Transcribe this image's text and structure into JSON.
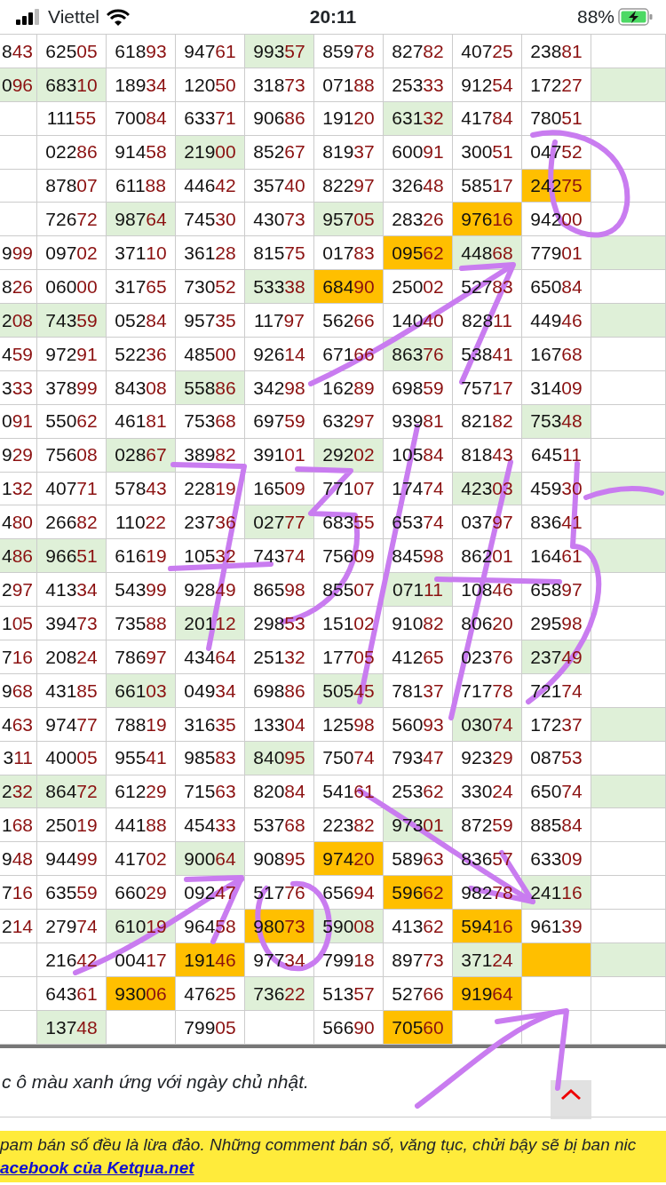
{
  "status_bar": {
    "carrier": "Viettel",
    "time": "20:11",
    "battery": "88%"
  },
  "rows": [
    [
      {
        "text": "843"
      },
      {
        "text": "62505"
      },
      {
        "text": "61893"
      },
      {
        "text": "94761"
      },
      {
        "text": "99357",
        "sunday": true
      },
      {
        "text": "85978"
      },
      {
        "text": "82782"
      },
      {
        "text": "40725"
      },
      {
        "text": "23881"
      },
      {}
    ],
    [
      {
        "text": "096",
        "sunday": true
      },
      {
        "text": "68310",
        "sunday": true
      },
      {
        "text": "18934"
      },
      {
        "text": "12050"
      },
      {
        "text": "31873"
      },
      {
        "text": "07188"
      },
      {
        "text": "25333"
      },
      {
        "text": "91254"
      },
      {
        "text": "17227"
      },
      {
        "sunday": true
      }
    ],
    [
      {},
      {
        "text": "11155"
      },
      {
        "text": "70084"
      },
      {
        "text": "63371"
      },
      {
        "text": "90686"
      },
      {
        "text": "19120"
      },
      {
        "text": "63132",
        "sunday": true
      },
      {
        "text": "41784"
      },
      {
        "text": "78051"
      },
      {}
    ],
    [
      {},
      {
        "text": "02286"
      },
      {
        "text": "91458"
      },
      {
        "text": "21900",
        "sunday": true
      },
      {
        "text": "85267"
      },
      {
        "text": "81937"
      },
      {
        "text": "60091"
      },
      {
        "text": "30051"
      },
      {
        "text": "04752"
      },
      {}
    ],
    [
      {},
      {
        "text": "87807"
      },
      {
        "text": "61188"
      },
      {
        "text": "44642"
      },
      {
        "text": "35740"
      },
      {
        "text": "82297"
      },
      {
        "text": "32648"
      },
      {
        "text": "58517"
      },
      {
        "text": "24275",
        "marked": true
      },
      {}
    ],
    [
      {},
      {
        "text": "72672"
      },
      {
        "text": "98764",
        "sunday": true
      },
      {
        "text": "74530"
      },
      {
        "text": "43073"
      },
      {
        "text": "95705",
        "sunday": true
      },
      {
        "text": "28326"
      },
      {
        "text": "97616",
        "marked": true
      },
      {
        "text": "94200"
      },
      {}
    ],
    [
      {
        "text": "999"
      },
      {
        "text": "09702"
      },
      {
        "text": "37110"
      },
      {
        "text": "36128"
      },
      {
        "text": "81575"
      },
      {
        "text": "01783"
      },
      {
        "text": "09562",
        "marked": true
      },
      {
        "text": "44868",
        "sunday": true
      },
      {
        "text": "77901"
      },
      {
        "sunday": true
      }
    ],
    [
      {
        "text": "826"
      },
      {
        "text": "06000"
      },
      {
        "text": "31765"
      },
      {
        "text": "73052"
      },
      {
        "text": "53338",
        "sunday": true
      },
      {
        "text": "68490",
        "marked": true
      },
      {
        "text": "25002"
      },
      {
        "text": "52783"
      },
      {
        "text": "65084"
      },
      {}
    ],
    [
      {
        "text": "208",
        "sunday": true
      },
      {
        "text": "74359",
        "sunday": true
      },
      {
        "text": "05284"
      },
      {
        "text": "95735"
      },
      {
        "text": "11797"
      },
      {
        "text": "56266"
      },
      {
        "text": "14040"
      },
      {
        "text": "82811"
      },
      {
        "text": "44946"
      },
      {
        "sunday": true
      }
    ],
    [
      {
        "text": "459"
      },
      {
        "text": "97291"
      },
      {
        "text": "52236"
      },
      {
        "text": "48500"
      },
      {
        "text": "92614"
      },
      {
        "text": "67166"
      },
      {
        "text": "86376",
        "sunday": true
      },
      {
        "text": "53841"
      },
      {
        "text": "16768"
      },
      {}
    ],
    [
      {
        "text": "333"
      },
      {
        "text": "37899"
      },
      {
        "text": "84308"
      },
      {
        "text": "55886",
        "sunday": true
      },
      {
        "text": "34298"
      },
      {
        "text": "16289"
      },
      {
        "text": "69859"
      },
      {
        "text": "75717"
      },
      {
        "text": "31409"
      },
      {}
    ],
    [
      {
        "text": "091"
      },
      {
        "text": "55062"
      },
      {
        "text": "46181"
      },
      {
        "text": "75368"
      },
      {
        "text": "69759"
      },
      {
        "text": "63297"
      },
      {
        "text": "93981"
      },
      {
        "text": "82182"
      },
      {
        "text": "75348",
        "sunday": true
      },
      {}
    ],
    [
      {
        "text": "929"
      },
      {
        "text": "75608"
      },
      {
        "text": "02867",
        "sunday": true
      },
      {
        "text": "38982"
      },
      {
        "text": "39101"
      },
      {
        "text": "29202",
        "sunday": true
      },
      {
        "text": "10584"
      },
      {
        "text": "81843"
      },
      {
        "text": "64511"
      },
      {}
    ],
    [
      {
        "text": "132"
      },
      {
        "text": "40771"
      },
      {
        "text": "57843"
      },
      {
        "text": "22819"
      },
      {
        "text": "16509"
      },
      {
        "text": "77107"
      },
      {
        "text": "17474"
      },
      {
        "text": "42303",
        "sunday": true
      },
      {
        "text": "45930"
      },
      {
        "sunday": true
      }
    ],
    [
      {
        "text": "480"
      },
      {
        "text": "26682"
      },
      {
        "text": "11022"
      },
      {
        "text": "23736"
      },
      {
        "text": "02777",
        "sunday": true
      },
      {
        "text": "68355"
      },
      {
        "text": "65374"
      },
      {
        "text": "03797"
      },
      {
        "text": "83641"
      },
      {}
    ],
    [
      {
        "text": "486",
        "sunday": true
      },
      {
        "text": "96651",
        "sunday": true
      },
      {
        "text": "61619"
      },
      {
        "text": "10532"
      },
      {
        "text": "74374"
      },
      {
        "text": "75609"
      },
      {
        "text": "84598"
      },
      {
        "text": "86201"
      },
      {
        "text": "16461"
      },
      {
        "sunday": true
      }
    ],
    [
      {
        "text": "297"
      },
      {
        "text": "41334"
      },
      {
        "text": "54399"
      },
      {
        "text": "92849"
      },
      {
        "text": "86598"
      },
      {
        "text": "85507"
      },
      {
        "text": "07111",
        "sunday": true
      },
      {
        "text": "10846"
      },
      {
        "text": "65897"
      },
      {}
    ],
    [
      {
        "text": "105"
      },
      {
        "text": "39473"
      },
      {
        "text": "73588"
      },
      {
        "text": "20112",
        "sunday": true
      },
      {
        "text": "29853"
      },
      {
        "text": "15102"
      },
      {
        "text": "91082"
      },
      {
        "text": "80620"
      },
      {
        "text": "29598"
      },
      {}
    ],
    [
      {
        "text": "716"
      },
      {
        "text": "20824"
      },
      {
        "text": "78697"
      },
      {
        "text": "43464"
      },
      {
        "text": "25132"
      },
      {
        "text": "17705"
      },
      {
        "text": "41265"
      },
      {
        "text": "02376"
      },
      {
        "text": "23749",
        "sunday": true
      },
      {}
    ],
    [
      {
        "text": "968"
      },
      {
        "text": "43185"
      },
      {
        "text": "66103",
        "sunday": true
      },
      {
        "text": "04934"
      },
      {
        "text": "69886"
      },
      {
        "text": "50545",
        "sunday": true
      },
      {
        "text": "78137"
      },
      {
        "text": "71778"
      },
      {
        "text": "72174"
      },
      {}
    ],
    [
      {
        "text": "463"
      },
      {
        "text": "97477"
      },
      {
        "text": "78819"
      },
      {
        "text": "31635"
      },
      {
        "text": "13304"
      },
      {
        "text": "12598"
      },
      {
        "text": "56093"
      },
      {
        "text": "03074",
        "sunday": true
      },
      {
        "text": "17237"
      },
      {
        "sunday": true
      }
    ],
    [
      {
        "text": "311"
      },
      {
        "text": "40005"
      },
      {
        "text": "95541"
      },
      {
        "text": "98583"
      },
      {
        "text": "84095",
        "sunday": true
      },
      {
        "text": "75074"
      },
      {
        "text": "79347"
      },
      {
        "text": "92329"
      },
      {
        "text": "08753"
      },
      {}
    ],
    [
      {
        "text": "232",
        "sunday": true
      },
      {
        "text": "86472",
        "sunday": true
      },
      {
        "text": "61229"
      },
      {
        "text": "71563"
      },
      {
        "text": "82084"
      },
      {
        "text": "54161"
      },
      {
        "text": "25362"
      },
      {
        "text": "33024"
      },
      {
        "text": "65074"
      },
      {
        "sunday": true
      }
    ],
    [
      {
        "text": "168"
      },
      {
        "text": "25019"
      },
      {
        "text": "44188"
      },
      {
        "text": "45433"
      },
      {
        "text": "53768"
      },
      {
        "text": "22382"
      },
      {
        "text": "97301",
        "sunday": true
      },
      {
        "text": "87259"
      },
      {
        "text": "88584"
      },
      {}
    ],
    [
      {
        "text": "948"
      },
      {
        "text": "94499"
      },
      {
        "text": "41702"
      },
      {
        "text": "90064",
        "sunday": true
      },
      {
        "text": "90895"
      },
      {
        "text": "97420",
        "marked": true
      },
      {
        "text": "58963"
      },
      {
        "text": "83657"
      },
      {
        "text": "63309"
      },
      {}
    ],
    [
      {
        "text": "716"
      },
      {
        "text": "63559"
      },
      {
        "text": "66029"
      },
      {
        "text": "09247"
      },
      {
        "text": "51776"
      },
      {
        "text": "65694"
      },
      {
        "text": "59662",
        "marked": true
      },
      {
        "text": "98278"
      },
      {
        "text": "24116",
        "sunday": true
      },
      {}
    ],
    [
      {
        "text": "214"
      },
      {
        "text": "27974"
      },
      {
        "text": "61019",
        "sunday": true
      },
      {
        "text": "96458"
      },
      {
        "text": "98073",
        "marked": true
      },
      {
        "text": "59008",
        "sunday": true
      },
      {
        "text": "41362"
      },
      {
        "text": "59416",
        "marked": true
      },
      {
        "text": "96139"
      },
      {}
    ],
    [
      {},
      {
        "text": "21642"
      },
      {
        "text": "00417"
      },
      {
        "text": "19146",
        "marked": true
      },
      {
        "text": "97734"
      },
      {
        "text": "79918"
      },
      {
        "text": "89773"
      },
      {
        "text": "37124",
        "sunday": true
      },
      {
        "marked": true
      },
      {
        "sunday": true
      }
    ],
    [
      {},
      {
        "text": "64361"
      },
      {
        "text": "93006",
        "marked": true
      },
      {
        "text": "47625"
      },
      {
        "text": "73622",
        "sunday": true
      },
      {
        "text": "51357"
      },
      {
        "text": "52766"
      },
      {
        "text": "91964",
        "marked": true
      },
      {},
      {}
    ],
    [
      {},
      {
        "text": "13748",
        "sunday": true
      },
      {},
      {
        "text": "79905"
      },
      {},
      {
        "text": "56690"
      },
      {
        "text": "70560",
        "marked": true
      },
      {},
      {},
      {}
    ]
  ],
  "note": "c ô màu xanh ứng với ngày chủ nhật.",
  "banner": {
    "text": "pam bán số đều là lừa đảo. Những comment bán số, văng tục, chửi bậy sẽ bị ban nic",
    "link": "acebook của Ketqua.net"
  }
}
